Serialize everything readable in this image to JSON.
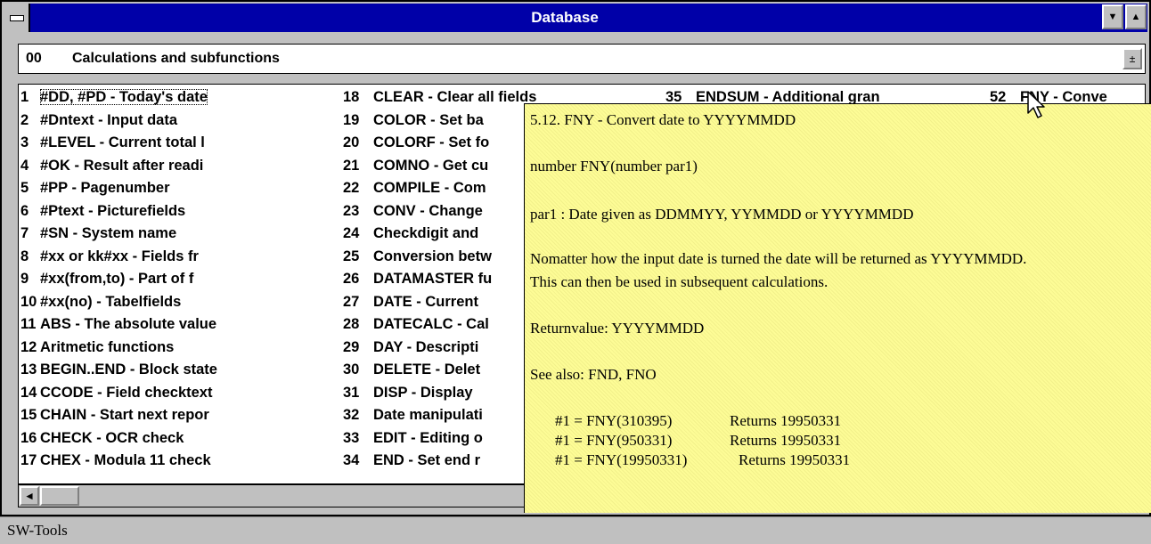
{
  "window": {
    "title": "Database",
    "sysmenu_icon": "system-menu-icon",
    "minimize_icon": "▼",
    "maximize_icon": "▲"
  },
  "dropdown": {
    "code": "00",
    "label": "Calculations and subfunctions",
    "button_icon": "±"
  },
  "list": {
    "columns": [
      [
        {
          "num": "1",
          "text": "#DD, #PD - Today's date",
          "selected": true
        },
        {
          "num": "2",
          "text": "#Dntext - Input data"
        },
        {
          "num": "3",
          "text": "#LEVEL - Current total l"
        },
        {
          "num": "4",
          "text": "#OK - Result after readi"
        },
        {
          "num": "5",
          "text": "#PP - Pagenumber"
        },
        {
          "num": "6",
          "text": "#Ptext - Picturefields"
        },
        {
          "num": "7",
          "text": "#SN - System name"
        },
        {
          "num": "8",
          "text": "#xx or kk#xx - Fields fr"
        },
        {
          "num": "9",
          "text": "#xx(from,to) - Part of f"
        },
        {
          "num": "10",
          "text": "#xx(no) - Tabelfields"
        },
        {
          "num": "11",
          "text": "ABS - The absolute value"
        },
        {
          "num": "12",
          "text": "Aritmetic functions"
        },
        {
          "num": "13",
          "text": "BEGIN..END - Block state"
        },
        {
          "num": "14",
          "text": "CCODE - Field checktext"
        },
        {
          "num": "15",
          "text": "CHAIN - Start next repor"
        },
        {
          "num": "16",
          "text": "CHECK - OCR check"
        },
        {
          "num": "17",
          "text": "CHEX - Modula 11 check"
        }
      ],
      [
        {
          "num": "18",
          "text": "CLEAR - Clear all fields"
        },
        {
          "num": "19",
          "text": "COLOR - Set ba"
        },
        {
          "num": "20",
          "text": "COLORF - Set fo"
        },
        {
          "num": "21",
          "text": "COMNO - Get cu"
        },
        {
          "num": "22",
          "text": "COMPILE - Com"
        },
        {
          "num": "23",
          "text": "CONV - Change"
        },
        {
          "num": "24",
          "text": "Checkdigit and"
        },
        {
          "num": "25",
          "text": "Conversion betw"
        },
        {
          "num": "26",
          "text": "DATAMASTER fu"
        },
        {
          "num": "27",
          "text": "DATE - Current"
        },
        {
          "num": "28",
          "text": "DATECALC - Cal"
        },
        {
          "num": "29",
          "text": "DAY - Descripti"
        },
        {
          "num": "30",
          "text": "DELETE - Delet"
        },
        {
          "num": "31",
          "text": "DISP - Display"
        },
        {
          "num": "32",
          "text": "Date manipulati"
        },
        {
          "num": "33",
          "text": "EDIT - Editing o"
        },
        {
          "num": "34",
          "text": "END - Set end r"
        }
      ],
      [
        {
          "num": "35",
          "text": "ENDSUM - Additional gran"
        }
      ],
      [
        {
          "num": "52",
          "text": "FNY - Conve"
        }
      ]
    ]
  },
  "tooltip": {
    "heading": "5.12. FNY - Convert date to YYYYMMDD",
    "syntax": "number FNY(number par1)",
    "param": "par1 : Date given as DDMMYY, YYMMDD or YYYYMMDD",
    "desc1": "Nomatter how the input date is turned the date will be returned as YYYYMMDD.",
    "desc2": "This can then be used in subsequent calculations.",
    "returns": "Returnvalue: YYYYMMDD",
    "see_also": "See also: FND, FNO",
    "examples": [
      {
        "code": "#1 = FNY(310395)",
        "result": "Returns 19950331"
      },
      {
        "code": "#1 = FNY(950331)",
        "result": "Returns 19950331"
      },
      {
        "code": "#1 = FNY(19950331)",
        "result": "Returns 19950331"
      }
    ]
  },
  "scrollbar": {
    "left_arrow": "◄"
  },
  "status": {
    "text": "SW-Tools"
  },
  "colors": {
    "titlebar": "#0000a8",
    "tooltip_bg": "#fdfc96",
    "chrome": "#c0c0c0"
  }
}
